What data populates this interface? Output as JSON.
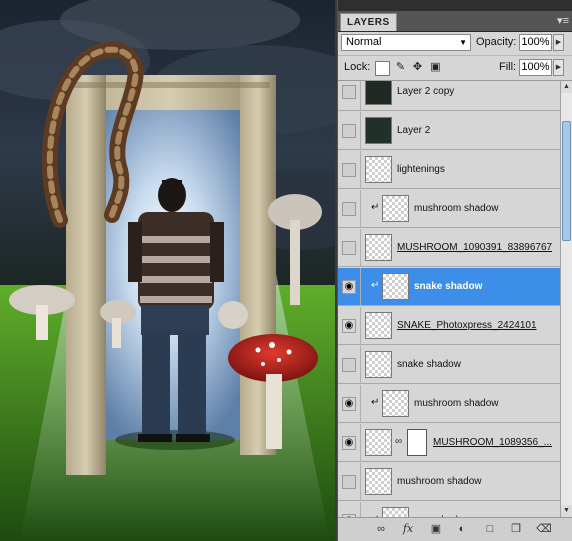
{
  "panel": {
    "tab_label": "LAYERS",
    "menu_icon": "panel-menu-icon",
    "blend_mode": "Normal",
    "opacity_label": "Opacity:",
    "opacity_value": "100%",
    "lock_label": "Lock:",
    "fill_label": "Fill:",
    "fill_value": "100%"
  },
  "layers": [
    {
      "name": "Layer 2 copy",
      "visible": false,
      "clipped": false,
      "underline": false,
      "thumb": "dark",
      "mask": false,
      "selected": false
    },
    {
      "name": "Layer 2",
      "visible": false,
      "clipped": false,
      "underline": false,
      "thumb": "dark2",
      "mask": false,
      "selected": false
    },
    {
      "name": "lightenings",
      "visible": false,
      "clipped": false,
      "underline": false,
      "thumb": "transparent",
      "mask": false,
      "selected": false
    },
    {
      "name": "mushroom shadow",
      "visible": false,
      "clipped": true,
      "underline": false,
      "thumb": "transparent",
      "mask": false,
      "selected": false
    },
    {
      "name": "MUSHROOM_1090391_83896767",
      "visible": false,
      "clipped": false,
      "underline": true,
      "thumb": "transparent",
      "mask": false,
      "selected": false
    },
    {
      "name": "snake shadow",
      "visible": true,
      "clipped": true,
      "underline": false,
      "thumb": "transparent",
      "mask": false,
      "selected": true
    },
    {
      "name": "SNAKE_Photoxpress_2424101",
      "visible": true,
      "clipped": false,
      "underline": true,
      "thumb": "transparent",
      "mask": false,
      "selected": false
    },
    {
      "name": "snake shadow",
      "visible": false,
      "clipped": false,
      "underline": false,
      "thumb": "transparent",
      "mask": false,
      "selected": false
    },
    {
      "name": "mushroom shadow",
      "visible": true,
      "clipped": true,
      "underline": false,
      "thumb": "transparent",
      "mask": false,
      "selected": false
    },
    {
      "name": "MUSHROOM_1089356_...",
      "visible": true,
      "clipped": false,
      "underline": true,
      "thumb": "transparent",
      "mask": true,
      "selected": false
    },
    {
      "name": "mushroom shadow",
      "visible": false,
      "clipped": false,
      "underline": false,
      "thumb": "transparent",
      "mask": false,
      "selected": false
    },
    {
      "name": "man shadow",
      "visible": true,
      "clipped": true,
      "underline": false,
      "thumb": "transparent",
      "mask": false,
      "selected": false
    }
  ],
  "footer_icons": [
    "link-layers-icon",
    "layer-style-fx-icon",
    "add-mask-icon",
    "adjustment-layer-icon",
    "new-group-icon",
    "new-layer-icon",
    "delete-layer-icon"
  ],
  "colors": {
    "selection": "#3d8ee8",
    "panel_bg": "#d6d6d6"
  }
}
